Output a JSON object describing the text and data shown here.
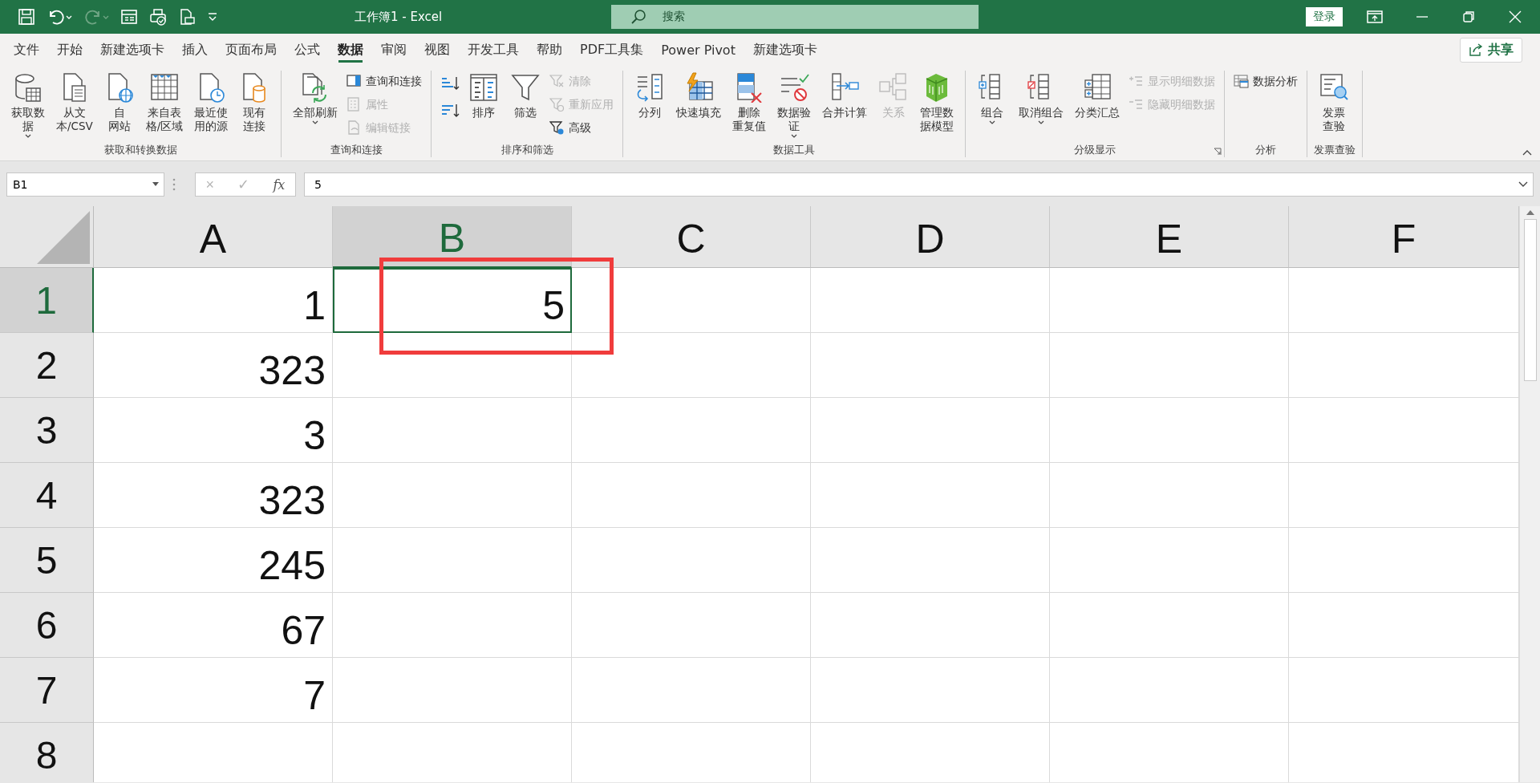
{
  "window": {
    "title": "工作簿1 - Excel",
    "search": {
      "placeholder": "搜索"
    },
    "login": "登录"
  },
  "tabs": [
    {
      "label": "文件",
      "selected": false
    },
    {
      "label": "开始",
      "selected": false
    },
    {
      "label": "新建选项卡",
      "selected": false
    },
    {
      "label": "插入",
      "selected": false
    },
    {
      "label": "页面布局",
      "selected": false
    },
    {
      "label": "公式",
      "selected": false
    },
    {
      "label": "数据",
      "selected": true
    },
    {
      "label": "审阅",
      "selected": false
    },
    {
      "label": "视图",
      "selected": false
    },
    {
      "label": "开发工具",
      "selected": false
    },
    {
      "label": "帮助",
      "selected": false
    },
    {
      "label": "PDF工具集",
      "selected": false
    },
    {
      "label": "Power Pivot",
      "selected": false
    },
    {
      "label": "新建选项卡",
      "selected": false
    }
  ],
  "share": "共享",
  "ribbon": {
    "groups": [
      {
        "label": "获取和转换数据",
        "launcher": false,
        "columns": [
          [
            {
              "kind": "large",
              "lines": [
                "获取数",
                "据"
              ],
              "dropdown": true,
              "disabled": false
            }
          ],
          [
            {
              "kind": "large",
              "lines": [
                "从文",
                "本/CSV"
              ],
              "dropdown": false,
              "disabled": false
            }
          ],
          [
            {
              "kind": "large",
              "lines": [
                "自",
                "网站"
              ],
              "dropdown": false,
              "disabled": false
            }
          ],
          [
            {
              "kind": "large",
              "lines": [
                "来自表",
                "格/区域"
              ],
              "dropdown": false,
              "disabled": false
            }
          ],
          [
            {
              "kind": "large",
              "lines": [
                "最近使",
                "用的源"
              ],
              "dropdown": false,
              "disabled": false
            }
          ],
          [
            {
              "kind": "large",
              "lines": [
                "现有",
                "连接"
              ],
              "dropdown": false,
              "disabled": false
            }
          ]
        ]
      },
      {
        "label": "查询和连接",
        "launcher": false,
        "columns": [
          [
            {
              "kind": "large",
              "label": "全部刷新",
              "dropdown": true,
              "disabled": false
            }
          ],
          [
            {
              "kind": "small",
              "label": "查询和连接",
              "disabled": false
            },
            {
              "kind": "small",
              "label": "属性",
              "disabled": true
            },
            {
              "kind": "small",
              "label": "编辑链接",
              "disabled": true
            }
          ]
        ]
      },
      {
        "label": "排序和筛选",
        "launcher": false,
        "columns": [
          [
            {
              "kind": "icon",
              "disabled": false
            },
            {
              "kind": "icon",
              "disabled": false
            }
          ],
          [
            {
              "kind": "large",
              "label": "排序",
              "dropdown": false,
              "disabled": false
            }
          ],
          [
            {
              "kind": "large",
              "label": "筛选",
              "dropdown": false,
              "disabled": false
            }
          ],
          [
            {
              "kind": "small",
              "label": "清除",
              "disabled": true
            },
            {
              "kind": "small",
              "label": "重新应用",
              "disabled": true
            },
            {
              "kind": "small",
              "label": "高级",
              "disabled": false
            }
          ]
        ]
      },
      {
        "label": "数据工具",
        "launcher": false,
        "columns": [
          [
            {
              "kind": "large",
              "label": "分列",
              "dropdown": false,
              "disabled": false
            }
          ],
          [
            {
              "kind": "large",
              "label": "快速填充",
              "dropdown": false,
              "disabled": false
            }
          ],
          [
            {
              "kind": "large",
              "lines": [
                "删除",
                "重复值"
              ],
              "dropdown": false,
              "disabled": false
            }
          ],
          [
            {
              "kind": "large",
              "lines": [
                "数据验",
                "证"
              ],
              "dropdown": true,
              "disabled": false
            }
          ],
          [
            {
              "kind": "large",
              "label": "合并计算",
              "dropdown": false,
              "disabled": false
            }
          ],
          [
            {
              "kind": "large",
              "label": "关系",
              "dropdown": false,
              "disabled": true
            }
          ],
          [
            {
              "kind": "large",
              "lines": [
                "管理数",
                "据模型"
              ],
              "dropdown": false,
              "disabled": false
            }
          ]
        ]
      },
      {
        "label": "分级显示",
        "launcher": true,
        "columns": [
          [
            {
              "kind": "large",
              "label": "组合",
              "dropdown": true,
              "disabled": false
            }
          ],
          [
            {
              "kind": "large",
              "label": "取消组合",
              "dropdown": true,
              "disabled": false
            }
          ],
          [
            {
              "kind": "large",
              "label": "分类汇总",
              "dropdown": false,
              "disabled": false
            }
          ],
          [
            {
              "kind": "small",
              "label": "显示明细数据",
              "disabled": true
            },
            {
              "kind": "small",
              "label": "隐藏明细数据",
              "disabled": true
            }
          ]
        ]
      },
      {
        "label": "分析",
        "launcher": false,
        "columns": [
          [
            {
              "kind": "small",
              "label": "数据分析",
              "disabled": false
            }
          ]
        ]
      },
      {
        "label": "发票查验",
        "launcher": false,
        "columns": [
          [
            {
              "kind": "large",
              "lines": [
                "发票",
                "查验"
              ],
              "dropdown": false,
              "disabled": false
            }
          ]
        ]
      }
    ]
  },
  "formula_bar": {
    "name_box": "B1",
    "buttons": [
      {
        "label": "×",
        "disabled": true
      },
      {
        "label": "✓",
        "disabled": true
      },
      {
        "label": "fx",
        "disabled": false
      }
    ],
    "value": "5"
  },
  "sheet": {
    "columns": [
      {
        "label": "A",
        "selected": false
      },
      {
        "label": "B",
        "selected": true
      },
      {
        "label": "C",
        "selected": false
      },
      {
        "label": "D",
        "selected": false
      },
      {
        "label": "E",
        "selected": false
      },
      {
        "label": "F",
        "selected": false
      }
    ],
    "rows": [
      {
        "label": "1",
        "selected": true,
        "cells": [
          {
            "value": "1",
            "selected": false
          },
          {
            "value": "5",
            "selected": true
          }
        ]
      },
      {
        "label": "2",
        "selected": false,
        "cells": [
          {
            "value": "323",
            "selected": false
          }
        ]
      },
      {
        "label": "3",
        "selected": false,
        "cells": [
          {
            "value": "3",
            "selected": false
          }
        ]
      },
      {
        "label": "4",
        "selected": false,
        "cells": [
          {
            "value": "323",
            "selected": false
          }
        ]
      },
      {
        "label": "5",
        "selected": false,
        "cells": [
          {
            "value": "245",
            "selected": false
          }
        ]
      },
      {
        "label": "6",
        "selected": false,
        "cells": [
          {
            "value": "67",
            "selected": false
          }
        ]
      },
      {
        "label": "7",
        "selected": false,
        "cells": [
          {
            "value": "7",
            "selected": false
          }
        ]
      },
      {
        "label": "8",
        "selected": false,
        "cells": []
      }
    ]
  },
  "annotation": {
    "kind": "box"
  }
}
